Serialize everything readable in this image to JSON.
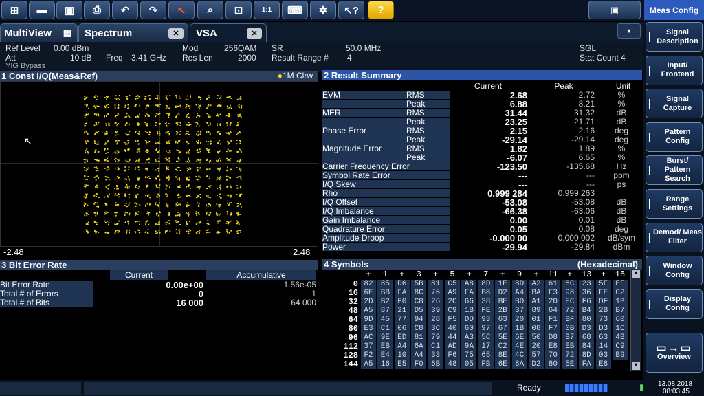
{
  "toolbar": {
    "icons": [
      "windows-icon",
      "open-icon",
      "save-icon",
      "print-icon",
      "undo-icon",
      "redo-icon",
      "pointer-icon",
      "zoom-icon",
      "multi-zoom-icon",
      "zoom-1to1-icon",
      "keyboard-icon",
      "network-icon",
      "help-pointer-icon",
      "help-icon"
    ]
  },
  "meas_config": "Meas Config",
  "tabs": {
    "multiview": "MultiView",
    "spectrum": "Spectrum",
    "vsa": "VSA"
  },
  "info": {
    "ref_level_label": "Ref Level",
    "ref_level": "0.00 dBm",
    "att_label": "Att",
    "att": "10 dB",
    "freq_label": "Freq",
    "freq": "3.41 GHz",
    "yig": "YIG Bypass",
    "mod_label": "Mod",
    "mod": "256QAM",
    "res_len_label": "Res Len",
    "res_len": "2000",
    "sr_label": "SR",
    "sr": "50.0 MHz",
    "result_range_label": "Result Range #",
    "result_range": "4",
    "sgl": "SGL",
    "stat_count": "Stat Count 4"
  },
  "const": {
    "title": "1 Const I/Q(Meas&Ref)",
    "trace": "1M Clrw",
    "x_min": "-2.48",
    "x_max": "2.48"
  },
  "result_summary": {
    "title": "2 Result Summary",
    "headers": {
      "current": "Current",
      "peak": "Peak",
      "unit": "Unit"
    },
    "rows": [
      {
        "name": "EVM",
        "sub": "RMS",
        "current": "2.68",
        "peak": "2.72",
        "unit": "%"
      },
      {
        "name": "",
        "sub": "Peak",
        "current": "6.88",
        "peak": "8.21",
        "unit": "%"
      },
      {
        "name": "MER",
        "sub": "RMS",
        "current": "31.44",
        "peak": "31.32",
        "unit": "dB"
      },
      {
        "name": "",
        "sub": "Peak",
        "current": "23.25",
        "peak": "21.71",
        "unit": "dB"
      },
      {
        "name": "Phase Error",
        "sub": "RMS",
        "current": "2.15",
        "peak": "2.16",
        "unit": "deg"
      },
      {
        "name": "",
        "sub": "Peak",
        "current": "-29.14",
        "peak": "-29.14",
        "unit": "deg"
      },
      {
        "name": "Magnitude Error",
        "sub": "RMS",
        "current": "1.82",
        "peak": "1.89",
        "unit": "%"
      },
      {
        "name": "",
        "sub": "Peak",
        "current": "-6.07",
        "peak": "6.65",
        "unit": "%"
      },
      {
        "name": "Carrier Frequency Error",
        "sub": "",
        "current": "-123.50",
        "peak": "-135.68",
        "unit": "Hz"
      },
      {
        "name": "Symbol Rate Error",
        "sub": "",
        "current": "---",
        "peak": "---",
        "unit": "ppm"
      },
      {
        "name": "I/Q Skew",
        "sub": "",
        "current": "---",
        "peak": "---",
        "unit": "ps"
      },
      {
        "name": "Rho",
        "sub": "",
        "current": "0.999 284",
        "peak": "0.999 263",
        "unit": ""
      },
      {
        "name": "I/Q Offset",
        "sub": "",
        "current": "-53.08",
        "peak": "-53.08",
        "unit": "dB"
      },
      {
        "name": "I/Q Imbalance",
        "sub": "",
        "current": "-66.38",
        "peak": "-63.06",
        "unit": "dB"
      },
      {
        "name": "Gain Imbalance",
        "sub": "",
        "current": "0.00",
        "peak": "0.01",
        "unit": "dB"
      },
      {
        "name": "Quadrature Error",
        "sub": "",
        "current": "0.05",
        "peak": "0.08",
        "unit": "deg"
      },
      {
        "name": "Amplitude Droop",
        "sub": "",
        "current": "-0.000 00",
        "peak": "0.000 002",
        "unit": "dB/sym"
      },
      {
        "name": "Power",
        "sub": "",
        "current": "-29.94",
        "peak": "-29.84",
        "unit": "dBm"
      }
    ]
  },
  "ber": {
    "title": "3 Bit Error Rate",
    "headers": {
      "current": "Current",
      "accumulative": "Accumulative"
    },
    "rows": [
      {
        "name": "Bit Error Rate",
        "current": "0.00e+00",
        "acc": "1.56e-05"
      },
      {
        "name": "Total # of Errors",
        "current": "0",
        "acc": "1"
      },
      {
        "name": "Total # of Bits",
        "current": "16 000",
        "acc": "64 000"
      }
    ]
  },
  "symbols": {
    "title": "4 Symbols",
    "format": "(Hexadecimal)",
    "col_headers": [
      "+",
      "1",
      "+",
      "3",
      "+",
      "5",
      "+",
      "7",
      "+",
      "9",
      "+",
      "11",
      "+",
      "13",
      "+",
      "15"
    ],
    "rows": [
      {
        "idx": "0",
        "vals": [
          "82",
          "85",
          "D6",
          "5B",
          "81",
          "C5",
          "A8",
          "8D",
          "1E",
          "8D",
          "A2",
          "61",
          "8C",
          "23",
          "5F",
          "EF"
        ]
      },
      {
        "idx": "16",
        "vals": [
          "6E",
          "BB",
          "FA",
          "8C",
          "76",
          "A9",
          "FA",
          "B8",
          "D2",
          "A4",
          "BA",
          "F3",
          "98",
          "36",
          "FE",
          "C2"
        ]
      },
      {
        "idx": "32",
        "vals": [
          "2D",
          "B2",
          "F0",
          "C8",
          "26",
          "2C",
          "66",
          "38",
          "BE",
          "BD",
          "A1",
          "2D",
          "EC",
          "F6",
          "DF",
          "1B"
        ]
      },
      {
        "idx": "48",
        "vals": [
          "A5",
          "87",
          "21",
          "D5",
          "39",
          "C9",
          "1B",
          "FE",
          "2B",
          "37",
          "89",
          "64",
          "72",
          "B4",
          "2B",
          "B7"
        ]
      },
      {
        "idx": "64",
        "vals": [
          "9D",
          "45",
          "77",
          "94",
          "28",
          "F5",
          "DD",
          "93",
          "63",
          "20",
          "01",
          "F1",
          "BF",
          "80",
          "73",
          "60"
        ]
      },
      {
        "idx": "80",
        "vals": [
          "E3",
          "C1",
          "06",
          "C8",
          "3C",
          "40",
          "60",
          "97",
          "67",
          "1B",
          "08",
          "F7",
          "0B",
          "D3",
          "D3",
          "1C"
        ]
      },
      {
        "idx": "96",
        "vals": [
          "AC",
          "9E",
          "ED",
          "81",
          "79",
          "44",
          "A3",
          "5C",
          "5E",
          "6E",
          "50",
          "D8",
          "B7",
          "68",
          "63",
          "4B"
        ]
      },
      {
        "idx": "112",
        "vals": [
          "37",
          "EB",
          "A4",
          "6A",
          "C1",
          "AD",
          "9A",
          "17",
          "C2",
          "4E",
          "20",
          "E8",
          "EB",
          "84",
          "14",
          "C9"
        ]
      },
      {
        "idx": "128",
        "vals": [
          "F2",
          "E4",
          "10",
          "A4",
          "33",
          "F6",
          "75",
          "65",
          "8E",
          "4C",
          "57",
          "70",
          "72",
          "8D",
          "03",
          "B9"
        ]
      },
      {
        "idx": "144",
        "vals": [
          "A5",
          "16",
          "E5",
          "F0",
          "6B",
          "48",
          "05",
          "FB",
          "6E",
          "8A",
          "D2",
          "80",
          "5E",
          "FA",
          "E8",
          ""
        ]
      }
    ]
  },
  "softkeys": [
    "Signal Description",
    "Input/ Frontend",
    "Signal Capture",
    "Pattern Config",
    "Burst/ Pattern Search",
    "Range Settings",
    "Demod/ Meas Filter",
    "Window Config",
    "Display Config"
  ],
  "overview": "Overview",
  "status": {
    "ready": "Ready",
    "date": "13.08.2018",
    "time": "08:03:45"
  }
}
